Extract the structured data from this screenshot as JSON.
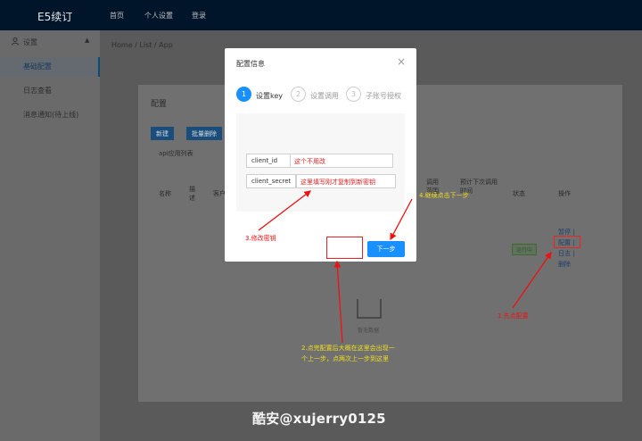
{
  "nav": {
    "brand": "E5续订",
    "items": [
      "首页",
      "个人设置",
      "登录"
    ]
  },
  "sidebar": {
    "group_label": "设置",
    "items": [
      {
        "label": "基础配置",
        "active": true
      },
      {
        "label": "日志查看",
        "active": false
      },
      {
        "label": "消息通知(待上线)",
        "active": false
      }
    ]
  },
  "breadcrumb": "Home  /  List  /  App",
  "card": {
    "title": "配置",
    "buttons": [
      "新建",
      "批量删除"
    ],
    "tab_label": "api应用列表",
    "columns": [
      "名称",
      "描述",
      "客户",
      "调用范围",
      "预计下次调用时间",
      "状态",
      "操作"
    ],
    "row": {
      "name": "",
      "desc": "",
      "client": "",
      "scope": "",
      "next_call": "",
      "status": "运行中",
      "ops": [
        "暂停 |",
        "配置 |",
        "日志 |",
        "删除"
      ]
    },
    "empty_text": "暂无数据"
  },
  "modal": {
    "title": "配置信息",
    "steps": [
      {
        "num": "1",
        "label": "设置key",
        "active": true
      },
      {
        "num": "2",
        "label": "设置调用",
        "active": false
      },
      {
        "num": "3",
        "label": "子账号授权",
        "active": false
      }
    ],
    "fields": [
      {
        "label": "client_id",
        "value": "这个不用改"
      },
      {
        "label": "client_secret",
        "value": "这里填写刚才复制到新密钥"
      }
    ],
    "next_button": "下一步"
  },
  "annotations": {
    "step1": "1.先点配置",
    "step2": [
      "2.点完配置后大概在这里会出现一",
      "个上一步，点两次上一步到这里"
    ],
    "step3": "3.修改密钥",
    "step4": "4.继续点击下一步"
  },
  "watermark": "酷安@xujerry0125",
  "colors": {
    "accent": "#1890ff",
    "annotation_red": "#e11111",
    "annotation_yellow": "#f2df1c",
    "topbar": "#001529"
  }
}
